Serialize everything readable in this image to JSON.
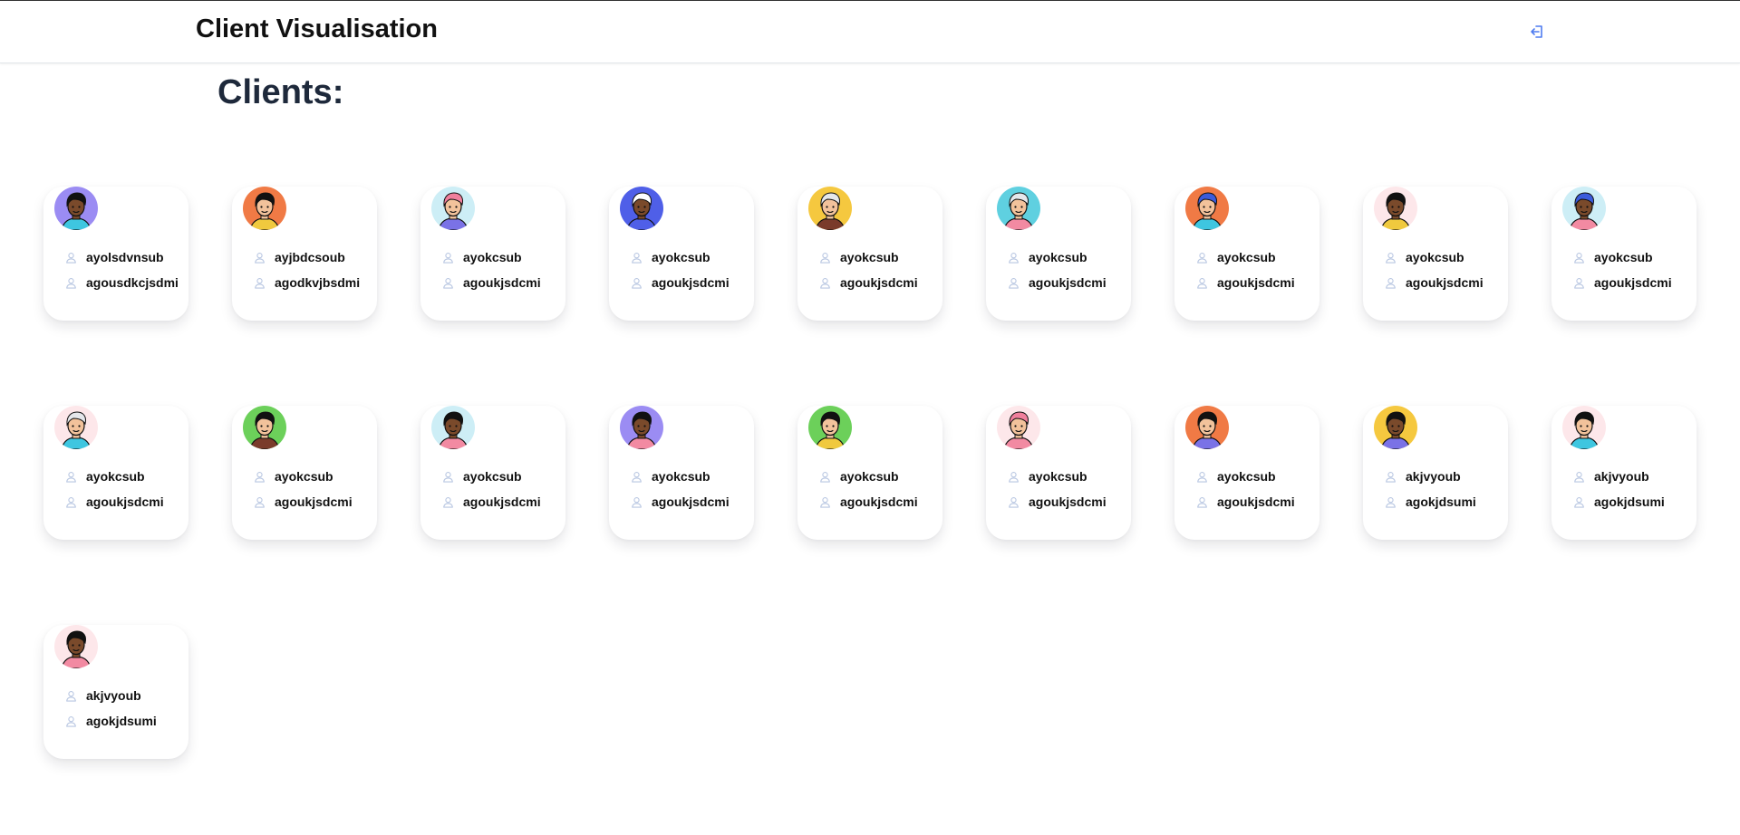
{
  "header": {
    "app_title": "Client Visualisation",
    "logout_icon": "logout-icon"
  },
  "page": {
    "heading": "Clients:"
  },
  "colors": {
    "accent": "#4f7cf0",
    "icon_light": "#b9c7e2",
    "text": "#111111",
    "heading": "#1e293b"
  },
  "clients": [
    {
      "first": "ayolsdvnsub",
      "second": "agousdkcjsdmi",
      "avatar_bg": "#9b8cf3",
      "skin": "#7a4a2b",
      "hair": "#111111",
      "shirt": "#3ec6e0"
    },
    {
      "first": "ayjbdcsoub",
      "second": "agodkvjbsdmi",
      "avatar_bg": "#f07a45",
      "skin": "#f2c29b",
      "hair": "#111111",
      "shirt": "#f0c93e"
    },
    {
      "first": "ayokcsub",
      "second": "agoukjsdcmi",
      "avatar_bg": "#cdeef6",
      "skin": "#f2c29b",
      "hair": "#f07f9c",
      "shirt": "#7a72e6"
    },
    {
      "first": "ayokcsub",
      "second": "agoukjsdcmi",
      "avatar_bg": "#4f5fe8",
      "skin": "#7a4a2b",
      "hair": "#ffffff",
      "shirt": "#4f5fe8"
    },
    {
      "first": "ayokcsub",
      "second": "agoukjsdcmi",
      "avatar_bg": "#f5c83f",
      "skin": "#f2c29b",
      "hair": "#e5e7eb",
      "shirt": "#7a3b2b"
    },
    {
      "first": "ayokcsub",
      "second": "agoukjsdcmi",
      "avatar_bg": "#5fd0e0",
      "skin": "#f2c29b",
      "hair": "#e5e7eb",
      "shirt": "#f28aa2"
    },
    {
      "first": "ayokcsub",
      "second": "agoukjsdcmi",
      "avatar_bg": "#f07a45",
      "skin": "#f2c29b",
      "hair": "#3b5bdb",
      "shirt": "#3ec6e0"
    },
    {
      "first": "ayokcsub",
      "second": "agoukjsdcmi",
      "avatar_bg": "#fde7ea",
      "skin": "#7a4a2b",
      "hair": "#111111",
      "shirt": "#f0c93e"
    },
    {
      "first": "ayokcsub",
      "second": "agoukjsdcmi",
      "avatar_bg": "#cdeef6",
      "skin": "#7a4a2b",
      "hair": "#3b5bdb",
      "shirt": "#f28aa2"
    },
    {
      "first": "ayokcsub",
      "second": "agoukjsdcmi",
      "avatar_bg": "#fde7ea",
      "skin": "#f2c29b",
      "hair": "#e5e7eb",
      "shirt": "#3ec6e0"
    },
    {
      "first": "ayokcsub",
      "second": "agoukjsdcmi",
      "avatar_bg": "#6cd05a",
      "skin": "#f2c29b",
      "hair": "#111111",
      "shirt": "#7a3b2b"
    },
    {
      "first": "ayokcsub",
      "second": "agoukjsdcmi",
      "avatar_bg": "#cdeef6",
      "skin": "#7a4a2b",
      "hair": "#111111",
      "shirt": "#f28aa2"
    },
    {
      "first": "ayokcsub",
      "second": "agoukjsdcmi",
      "avatar_bg": "#9b8cf3",
      "skin": "#7a4a2b",
      "hair": "#111111",
      "shirt": "#f28aa2"
    },
    {
      "first": "ayokcsub",
      "second": "agoukjsdcmi",
      "avatar_bg": "#6cd05a",
      "skin": "#f2c29b",
      "hair": "#111111",
      "shirt": "#f0c93e"
    },
    {
      "first": "ayokcsub",
      "second": "agoukjsdcmi",
      "avatar_bg": "#fde7ea",
      "skin": "#f2c29b",
      "hair": "#f07f9c",
      "shirt": "#f28aa2"
    },
    {
      "first": "ayokcsub",
      "second": "agoukjsdcmi",
      "avatar_bg": "#f07a45",
      "skin": "#f2c29b",
      "hair": "#111111",
      "shirt": "#7a72e6"
    },
    {
      "first": "akjvyoub",
      "second": "agokjdsumi",
      "avatar_bg": "#f5c83f",
      "skin": "#7a4a2b",
      "hair": "#111111",
      "shirt": "#7a72e6"
    },
    {
      "first": "akjvyoub",
      "second": "agokjdsumi",
      "avatar_bg": "#fde7ea",
      "skin": "#f2c29b",
      "hair": "#111111",
      "shirt": "#3ec6e0"
    },
    {
      "first": "akjvyoub",
      "second": "agokjdsumi",
      "avatar_bg": "#fde7ea",
      "skin": "#7a4a2b",
      "hair": "#111111",
      "shirt": "#f28aa2"
    }
  ]
}
